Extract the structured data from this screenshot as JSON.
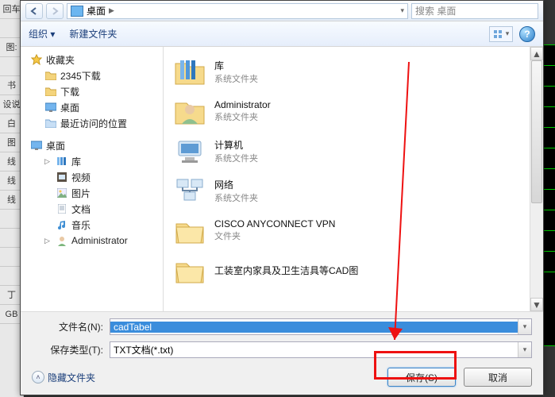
{
  "addressbar": {
    "location": "桌面",
    "dropdown": "▾"
  },
  "search": {
    "placeholder": "搜索 桌面"
  },
  "toolbar": {
    "organize": "组织 ▾",
    "newfolder": "新建文件夹"
  },
  "nav": {
    "favorites": "收藏夹",
    "fav_items": [
      "2345下载",
      "下载",
      "桌面",
      "最近访问的位置"
    ],
    "desktop": "桌面",
    "library": "库",
    "lib_items": [
      "视频",
      "图片",
      "文档",
      "音乐"
    ],
    "admin": "Administrator"
  },
  "list": [
    {
      "title": "库",
      "sub": "系统文件夹",
      "icon": "library"
    },
    {
      "title": "Administrator",
      "sub": "系统文件夹",
      "icon": "user"
    },
    {
      "title": "计算机",
      "sub": "系统文件夹",
      "icon": "computer"
    },
    {
      "title": "网络",
      "sub": "系统文件夹",
      "icon": "network"
    },
    {
      "title": "CISCO ANYCONNECT VPN",
      "sub": "文件夹",
      "icon": "folder"
    },
    {
      "title": "工装室内家具及卫生洁具等CAD图",
      "sub": "",
      "icon": "folder"
    }
  ],
  "filename": {
    "label": "文件名(N):",
    "value": "cadTabel"
  },
  "filetype": {
    "label": "保存类型(T):",
    "value": "TXT文档(*.txt)"
  },
  "hide": "隐藏文件夹",
  "save": "保存(S)",
  "cancel": "取消",
  "leftlabels": [
    "回车",
    "",
    "图:",
    "",
    "书",
    "设说",
    "白",
    "图",
    "线",
    "线",
    "线",
    "",
    "",
    "",
    "",
    "丁",
    "GB"
  ]
}
